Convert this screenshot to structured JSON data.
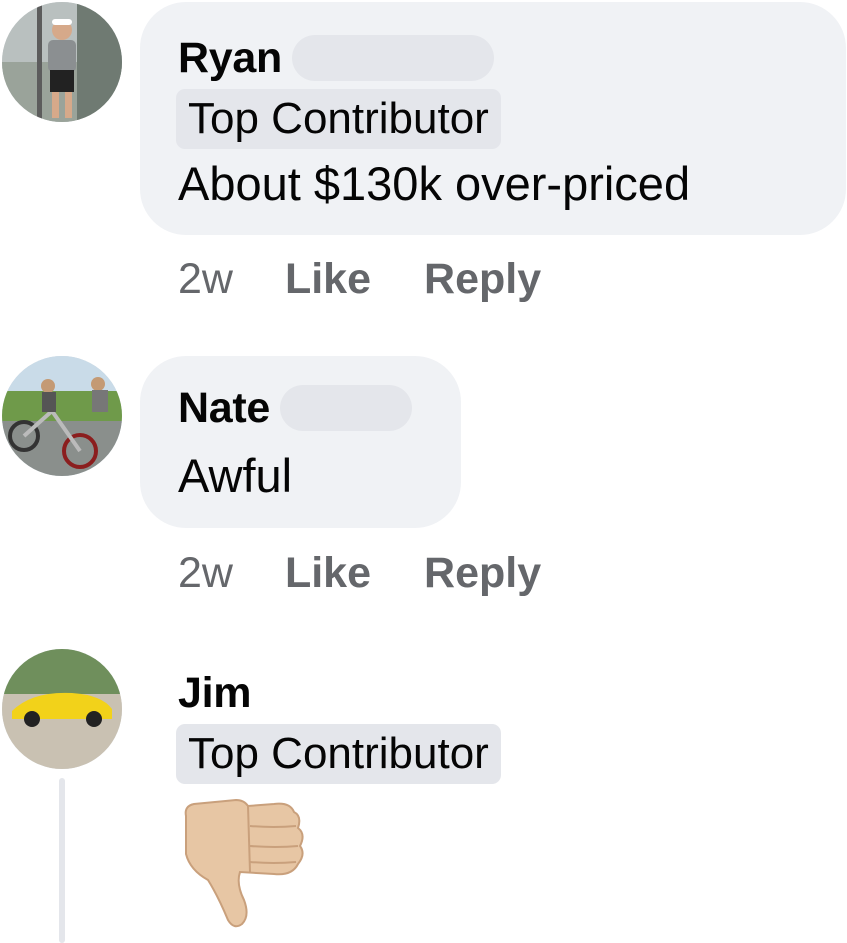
{
  "comments": [
    {
      "author": "Ryan",
      "badge": "Top Contributor",
      "text": "About $130k over-priced",
      "time": "2w",
      "like_label": "Like",
      "reply_label": "Reply"
    },
    {
      "author": "Nate",
      "text": "Awful",
      "time": "2w",
      "like_label": "Like",
      "reply_label": "Reply"
    },
    {
      "author": "Jim",
      "badge": "Top Contributor",
      "reaction_icon": "thumbs-down-emoji"
    }
  ],
  "colors": {
    "bubble_bg": "#f0f2f5",
    "badge_bg": "#e4e6eb",
    "meta_text": "#65676b",
    "primary_text": "#050505"
  }
}
